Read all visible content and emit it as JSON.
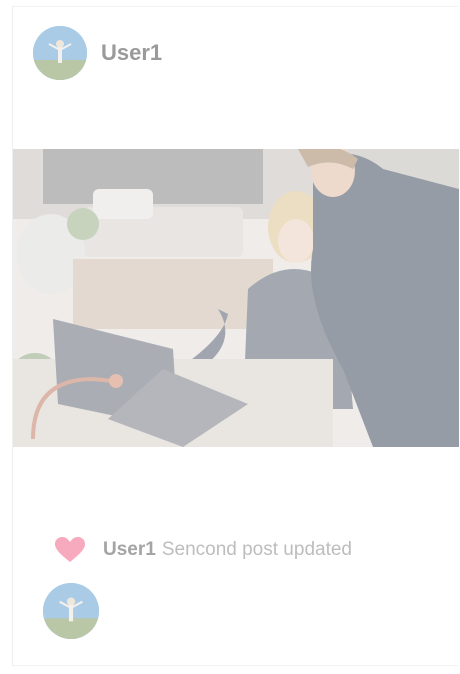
{
  "post": {
    "author": "User1",
    "caption_user": "User1",
    "caption_text": "Sencond post updated"
  },
  "icons": {
    "like": "heart-icon",
    "avatar": "user-avatar"
  },
  "colors": {
    "heart": "#f7a9be",
    "username": "#9a9a9a",
    "caption": "#bdbdbd"
  }
}
